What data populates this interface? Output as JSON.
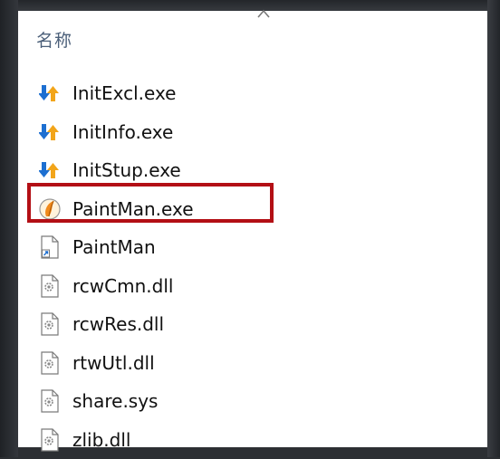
{
  "header": {
    "name_label": "名称"
  },
  "files": [
    {
      "name": "InitExcl.exe",
      "icon": "installer-arrows-icon"
    },
    {
      "name": "InitInfo.exe",
      "icon": "installer-arrows-icon"
    },
    {
      "name": "InitStup.exe",
      "icon": "installer-arrows-icon"
    },
    {
      "name": "PaintMan.exe",
      "icon": "paintman-app-icon"
    },
    {
      "name": "PaintMan",
      "icon": "shortcut-file-icon"
    },
    {
      "name": "rcwCmn.dll",
      "icon": "dll-gear-file-icon"
    },
    {
      "name": "rcwRes.dll",
      "icon": "dll-gear-file-icon"
    },
    {
      "name": "rtwUtl.dll",
      "icon": "dll-gear-file-icon"
    },
    {
      "name": "share.sys",
      "icon": "dll-gear-file-icon"
    },
    {
      "name": "zlib.dll",
      "icon": "dll-gear-file-icon"
    }
  ],
  "colors": {
    "highlight_border": "#b30f15",
    "header_text": "#4c607a",
    "background": "#2c2f33"
  }
}
